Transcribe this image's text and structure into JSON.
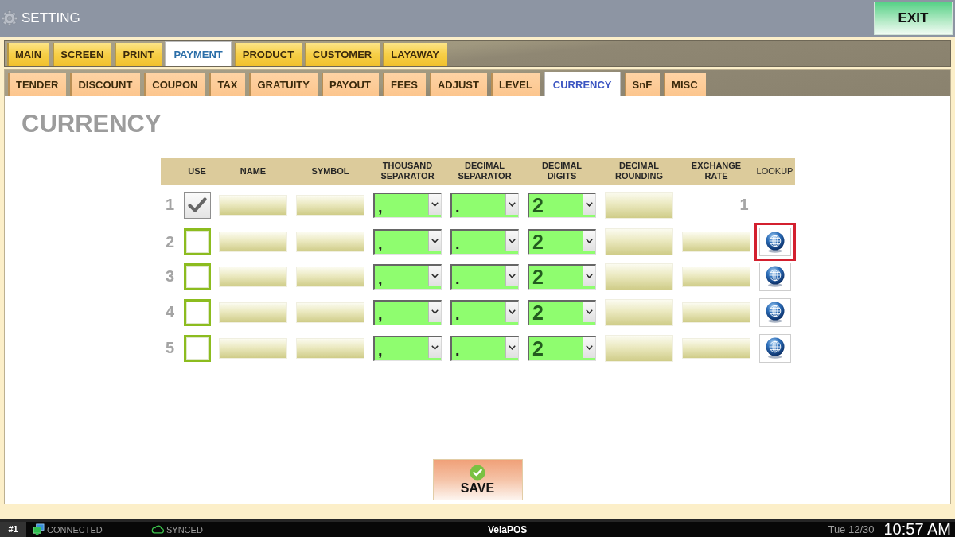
{
  "window": {
    "title": "SETTING",
    "exit_button": "EXIT"
  },
  "tabs": [
    {
      "label": "MAIN",
      "selected": false
    },
    {
      "label": "SCREEN",
      "selected": false
    },
    {
      "label": "PRINT",
      "selected": false
    },
    {
      "label": "PAYMENT",
      "selected": true
    },
    {
      "label": "PRODUCT",
      "selected": false
    },
    {
      "label": "CUSTOMER",
      "selected": false
    },
    {
      "label": "LAYAWAY",
      "selected": false
    }
  ],
  "subtabs": [
    {
      "label": "TENDER",
      "selected": false
    },
    {
      "label": "DISCOUNT",
      "selected": false
    },
    {
      "label": "COUPON",
      "selected": false
    },
    {
      "label": "TAX",
      "selected": false
    },
    {
      "label": "GRATUITY",
      "selected": false
    },
    {
      "label": "PAYOUT",
      "selected": false
    },
    {
      "label": "FEES",
      "selected": false
    },
    {
      "label": "ADJUST",
      "selected": false
    },
    {
      "label": "LEVEL",
      "selected": false
    },
    {
      "label": "CURRENCY",
      "selected": true
    },
    {
      "label": "SnF",
      "selected": false
    },
    {
      "label": "MISC",
      "selected": false
    }
  ],
  "page": {
    "heading": "CURRENCY"
  },
  "table": {
    "columns": [
      "USE",
      "NAME",
      "SYMBOL",
      "THOUSAND SEPARATOR",
      "DECIMAL SEPARATOR",
      "DECIMAL DIGITS",
      "DECIMAL ROUNDING",
      "EXCHANGE RATE",
      "LOOKUP"
    ],
    "rows": [
      {
        "number": "1",
        "kind": "base",
        "checked": true,
        "thousand_separator": ",",
        "decimal_separator": ".",
        "decimal_digits": "2",
        "exchange_rate": "1"
      },
      {
        "number": "2",
        "kind": "foreign",
        "checked": false,
        "thousand_separator": ",",
        "decimal_separator": ".",
        "decimal_digits": "2",
        "highlighted": true
      },
      {
        "number": "3",
        "kind": "foreign",
        "checked": false,
        "thousand_separator": ",",
        "decimal_separator": ".",
        "decimal_digits": "2",
        "highlighted": false
      },
      {
        "number": "4",
        "kind": "foreign",
        "checked": false,
        "thousand_separator": ",",
        "decimal_separator": ".",
        "decimal_digits": "2",
        "highlighted": false
      },
      {
        "number": "5",
        "kind": "foreign",
        "checked": false,
        "thousand_separator": ",",
        "decimal_separator": ".",
        "decimal_digits": "2",
        "highlighted": false
      }
    ]
  },
  "save_button": "SAVE",
  "status_bar": {
    "terminal": "#1",
    "connection": "CONNECTED",
    "sync": "SYNCED",
    "app_name": "VelaPOS",
    "date": "Tue 12/30",
    "time": "10:57 AM"
  }
}
